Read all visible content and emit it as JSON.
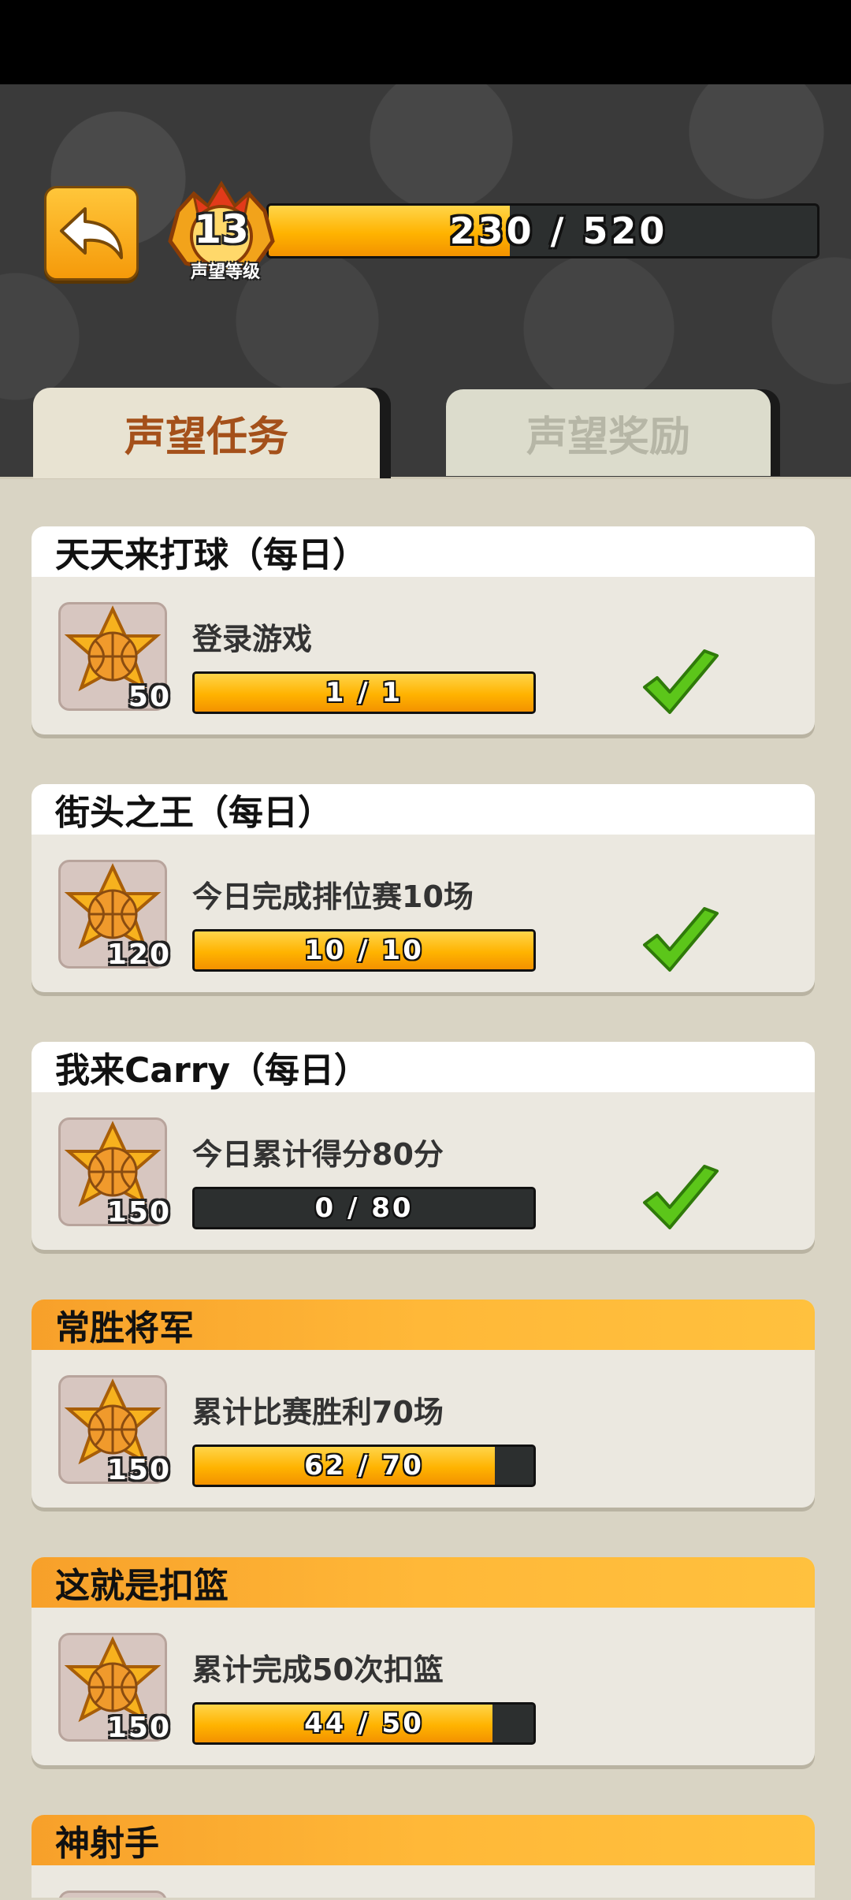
{
  "header": {
    "level": "13",
    "level_label": "声望等级",
    "xp_text": "230 / 520",
    "xp_progress": 0.44
  },
  "tabs": [
    {
      "label": "声望任务",
      "active": true
    },
    {
      "label": "声望奖励",
      "active": false
    }
  ],
  "tasks": [
    {
      "title": "天天来打球（每日）",
      "desc": "登录游戏",
      "reward": "50",
      "progress_text": "1 / 1",
      "progress": 1.0,
      "completed": true,
      "header_style": "white"
    },
    {
      "title": "街头之王（每日）",
      "desc": "今日完成排位赛10场",
      "reward": "120",
      "progress_text": "10 / 10",
      "progress": 1.0,
      "completed": true,
      "header_style": "white"
    },
    {
      "title": "我来Carry（每日）",
      "desc": "今日累计得分80分",
      "reward": "150",
      "progress_text": "0 / 80",
      "progress": 0.0,
      "completed": true,
      "header_style": "white"
    },
    {
      "title": "常胜将军",
      "desc": "累计比赛胜利70场",
      "reward": "150",
      "progress_text": "62 / 70",
      "progress": 0.886,
      "completed": false,
      "header_style": "orange"
    },
    {
      "title": "这就是扣篮",
      "desc": "累计完成50次扣篮",
      "reward": "150",
      "progress_text": "44 / 50",
      "progress": 0.88,
      "completed": false,
      "header_style": "orange"
    },
    {
      "title": "神射手",
      "desc": "",
      "reward": "",
      "progress_text": "",
      "progress": 0,
      "completed": false,
      "header_style": "orange"
    }
  ],
  "colors": {
    "accent_orange": "#ffb300",
    "check_green": "#5cc61a",
    "active_tab_text": "#a4501a"
  }
}
